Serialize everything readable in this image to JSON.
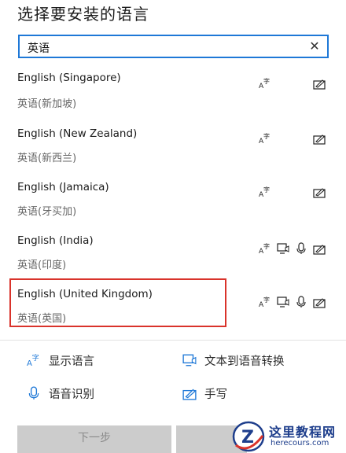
{
  "header": {
    "title": "选择要安装的语言"
  },
  "search": {
    "value": "英语"
  },
  "languages": [
    {
      "name": "English (Singapore)",
      "native": "英语(新加坡)",
      "features": [
        "display-language-icon",
        "handwriting-icon"
      ]
    },
    {
      "name": "English (New Zealand)",
      "native": "英语(新西兰)",
      "features": [
        "display-language-icon",
        "handwriting-icon"
      ]
    },
    {
      "name": "English (Jamaica)",
      "native": "英语(牙买加)",
      "features": [
        "display-language-icon",
        "handwriting-icon"
      ]
    },
    {
      "name": "English (India)",
      "native": "英语(印度)",
      "features": [
        "display-language-icon",
        "text-to-speech-icon",
        "speech-icon",
        "handwriting-icon"
      ]
    },
    {
      "name": "English (United Kingdom)",
      "native": "英语(英国)",
      "features": [
        "display-language-icon",
        "text-to-speech-icon",
        "speech-icon",
        "handwriting-icon"
      ],
      "selected": true
    }
  ],
  "legend": {
    "display_language": "显示语言",
    "text_to_speech": "文本到语音转换",
    "speech_recognition": "语音识别",
    "handwriting": "手写"
  },
  "buttons": {
    "next": "下一步"
  },
  "watermark": {
    "title": "这里教程网",
    "url": "herecours.com"
  },
  "colors": {
    "accent": "#1e78d7",
    "highlight": "#d9332b",
    "icon": "#1e78d7"
  }
}
